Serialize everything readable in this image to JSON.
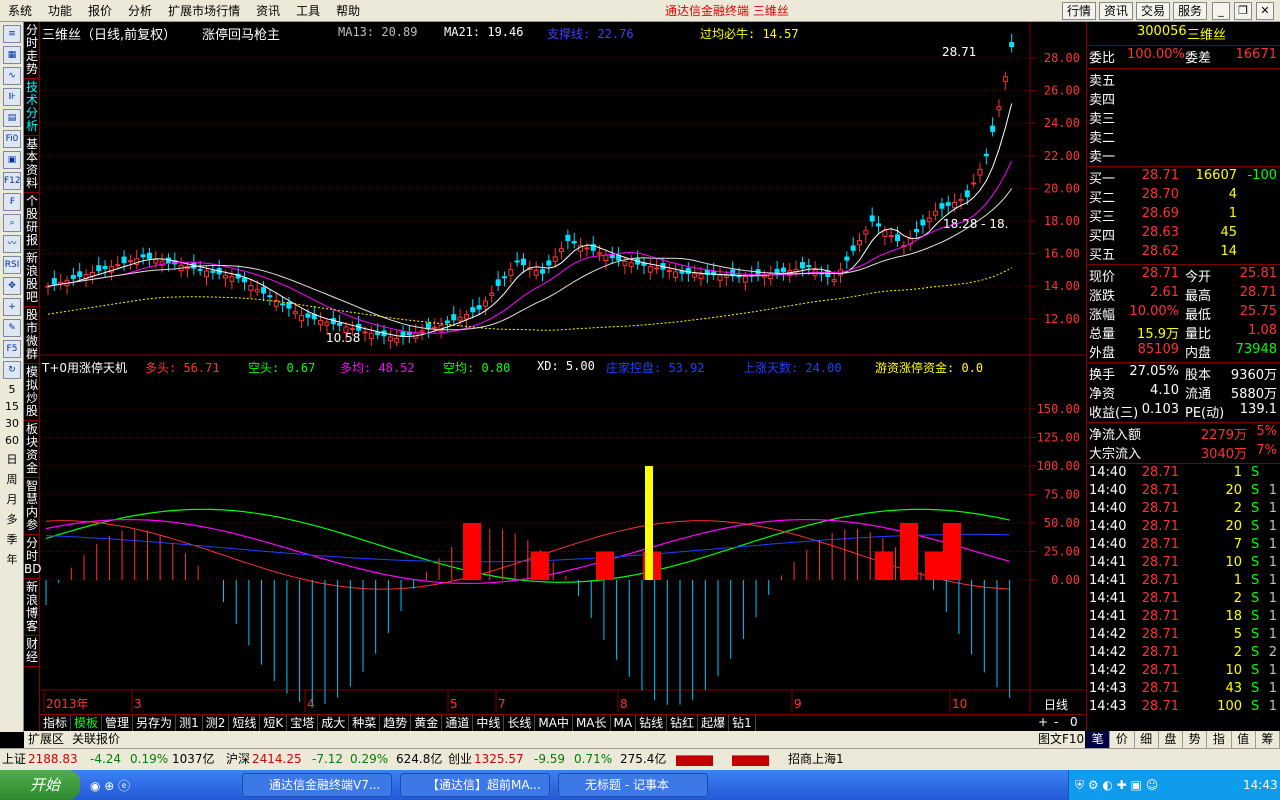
{
  "menu": {
    "items": [
      "系统",
      "功能",
      "报价",
      "分析",
      "扩展市场行情",
      "资讯",
      "工具",
      "帮助"
    ],
    "window_title": "通达信金融终端  三维丝",
    "right_buttons": [
      "行情",
      "资讯",
      "交易",
      "服务"
    ]
  },
  "left_tools": [
    "分时走势",
    "技术分析",
    "基本资料",
    "个股研报",
    "新浪股吧",
    "股市微群",
    "模拟炒股",
    "板块资金",
    "智慧内参",
    "分时BD",
    "新浪博客",
    "财经"
  ],
  "left_tool_icons": [
    "RSI",
    "Fi0",
    "F12",
    "F5"
  ],
  "period_tabs": [
    "5",
    "15",
    "30",
    "60",
    "日",
    "周",
    "月",
    "多",
    "季",
    "年"
  ],
  "chart": {
    "title": "三维丝（日线,前复权）",
    "indicator_name": "涨停回马枪主",
    "ma13": "MA13: 20.89",
    "ma21": "MA21: 19.46",
    "support": "支撑线: 22.76",
    "over_avg": "过均必牛: 14.57",
    "high_label": "28.71",
    "low_label": "10.58",
    "range_label": "18.28 - 18.",
    "price_ticks": [
      "28.00",
      "26.00",
      "24.00",
      "22.00",
      "20.00",
      "18.00",
      "16.00",
      "14.00",
      "12.00"
    ],
    "sub_title": "T+0用涨停天机",
    "bull": "多头: 56.71",
    "bear": "空头: 0.67",
    "bull_avg": "多均: 48.52",
    "bear_avg": "空均: 0.80",
    "xd": "XD: 5.00",
    "main_ctrl": "庄家控盘: 53.92",
    "rise_days": "上涨天数: 24.00",
    "hot_money": "游资涨停资金: 0.0",
    "sub_ticks": [
      "150.00",
      "125.00",
      "100.00",
      "75.00",
      "50.00",
      "25.00",
      "0.00"
    ],
    "date_labels": [
      "2013年",
      "3",
      "4",
      "5",
      "7",
      "8",
      "9",
      "10"
    ],
    "period_label": "日线",
    "colors": {
      "up": "#ff3232",
      "down": "#00e0ff",
      "ma_white": "#ffffff",
      "ma_magenta": "#ff00ff",
      "ma_yellow": "#ffff00",
      "grid": "#800000"
    }
  },
  "bottom_tabs": [
    "指标",
    "模板",
    "管理",
    "另存为",
    "测1",
    "测2",
    "短线",
    "短K",
    "宝塔",
    "成大",
    "种菜",
    "趋势",
    "黄金",
    "通道",
    "中线",
    "长线",
    "MA中",
    "MA长",
    "MA",
    "钻线",
    "钻红",
    "起爆",
    "钻1"
  ],
  "ext_tabs": [
    "扩展区",
    "关联报价"
  ],
  "zoom_controls": [
    "+",
    "-",
    "0"
  ],
  "graph_label": "图文F10",
  "quote": {
    "code": "300056",
    "name": "三维丝",
    "weibi_label": "委比",
    "weibi": "100.00%",
    "weicha_label": "委差",
    "weicha": "16671",
    "sells": [
      {
        "label": "卖五"
      },
      {
        "label": "卖四"
      },
      {
        "label": "卖三"
      },
      {
        "label": "卖二"
      },
      {
        "label": "卖一"
      }
    ],
    "buys": [
      {
        "label": "买一",
        "price": "28.71",
        "vol": "16607",
        "chg": "-100"
      },
      {
        "label": "买二",
        "price": "28.70",
        "vol": "4",
        "chg": ""
      },
      {
        "label": "买三",
        "price": "28.69",
        "vol": "1",
        "chg": ""
      },
      {
        "label": "买四",
        "price": "28.63",
        "vol": "45",
        "chg": ""
      },
      {
        "label": "买五",
        "price": "28.62",
        "vol": "14",
        "chg": ""
      }
    ],
    "stats": [
      {
        "l1": "现价",
        "v1": "28.71",
        "l2": "今开",
        "v2": "25.81"
      },
      {
        "l1": "涨跌",
        "v1": "2.61",
        "l2": "最高",
        "v2": "28.71"
      },
      {
        "l1": "涨幅",
        "v1": "10.00%",
        "l2": "最低",
        "v2": "25.75"
      },
      {
        "l1": "总量",
        "v1": "15.9万",
        "l2": "量比",
        "v2": "1.08"
      },
      {
        "l1": "外盘",
        "v1": "85109",
        "l2": "内盘",
        "v2": "73948"
      }
    ],
    "stats2": [
      {
        "l1": "换手",
        "v1": "27.05%",
        "l2": "股本",
        "v2": "9360万"
      },
      {
        "l1": "净资",
        "v1": "4.10",
        "l2": "流通",
        "v2": "5880万"
      },
      {
        "l1": "收益(三)",
        "v1": "0.103",
        "l2": "PE(动)",
        "v2": "139.1"
      }
    ],
    "flow": [
      {
        "l": "净流入额",
        "v": "2279万",
        "p": "5%"
      },
      {
        "l": "大宗流入",
        "v": "3040万",
        "p": "7%"
      }
    ],
    "ticks": [
      {
        "t": "14:40",
        "p": "28.71",
        "v": "1",
        "s": "S",
        "n": ""
      },
      {
        "t": "14:40",
        "p": "28.71",
        "v": "20",
        "s": "S",
        "n": "1"
      },
      {
        "t": "14:40",
        "p": "28.71",
        "v": "2",
        "s": "S",
        "n": "1"
      },
      {
        "t": "14:40",
        "p": "28.71",
        "v": "20",
        "s": "S",
        "n": "1"
      },
      {
        "t": "14:40",
        "p": "28.71",
        "v": "7",
        "s": "S",
        "n": "1"
      },
      {
        "t": "14:41",
        "p": "28.71",
        "v": "10",
        "s": "S",
        "n": "1"
      },
      {
        "t": "14:41",
        "p": "28.71",
        "v": "1",
        "s": "S",
        "n": "1"
      },
      {
        "t": "14:41",
        "p": "28.71",
        "v": "2",
        "s": "S",
        "n": "1"
      },
      {
        "t": "14:41",
        "p": "28.71",
        "v": "18",
        "s": "S",
        "n": "1"
      },
      {
        "t": "14:42",
        "p": "28.71",
        "v": "5",
        "s": "S",
        "n": "1"
      },
      {
        "t": "14:42",
        "p": "28.71",
        "v": "2",
        "s": "S",
        "n": "2"
      },
      {
        "t": "14:42",
        "p": "28.71",
        "v": "10",
        "s": "S",
        "n": "1"
      },
      {
        "t": "14:43",
        "p": "28.71",
        "v": "43",
        "s": "S",
        "n": "1"
      },
      {
        "t": "14:43",
        "p": "28.71",
        "v": "100",
        "s": "S",
        "n": "1"
      }
    ],
    "bottom_tabs": [
      "笔",
      "价",
      "细",
      "盘",
      "势",
      "指",
      "值",
      "筹"
    ]
  },
  "status": {
    "sh_label": "上证",
    "sh": "2188.83",
    "sh_chg": "-4.24",
    "sh_pct": "0.19%",
    "sh_amt": "1037亿",
    "hs_label": "沪深",
    "hs": "2414.25",
    "hs_chg": "-7.12",
    "hs_pct": "0.29%",
    "hs_amt": "624.8亿",
    "cy_label": "创业",
    "cy": "1325.57",
    "cy_chg": "-9.59",
    "cy_pct": "0.71%",
    "cy_amt": "275.4亿",
    "broker": "招商上海1"
  },
  "taskbar": {
    "start": "开始",
    "windows": [
      "通达信金融终端V7...",
      "【通达信】超前MA...",
      "无标题 - 记事本"
    ],
    "clock": "14:43"
  }
}
